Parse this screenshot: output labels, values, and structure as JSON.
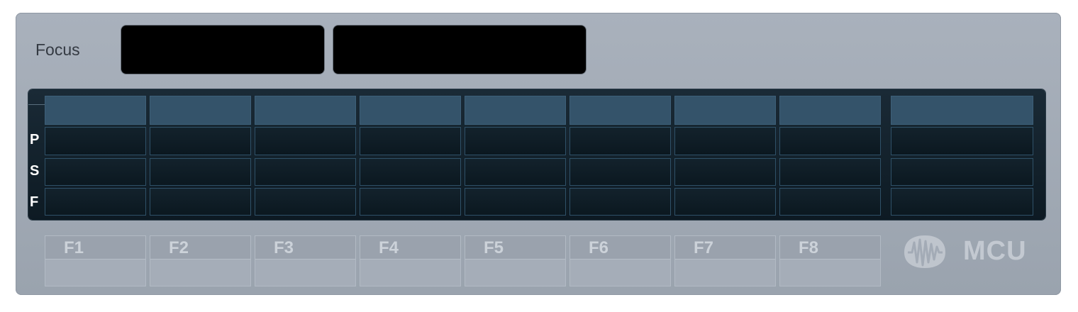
{
  "header": {
    "focus_label": "Focus",
    "lcd_left_text": "",
    "lcd_right_text": ""
  },
  "strip": {
    "row_labels": [
      "P",
      "S",
      "F"
    ],
    "channel_count": 9
  },
  "fkeys": [
    "F1",
    "F2",
    "F3",
    "F4",
    "F5",
    "F6",
    "F7",
    "F8"
  ],
  "brand": {
    "text": "MCU",
    "icon": "presonus-waveform-logo-icon"
  },
  "colors": {
    "panel": "#a9b1bc",
    "strip_background": "#0d1a23",
    "strip_header": "#34536a",
    "cell_border": "#2f5168",
    "lcd": "#000000"
  }
}
